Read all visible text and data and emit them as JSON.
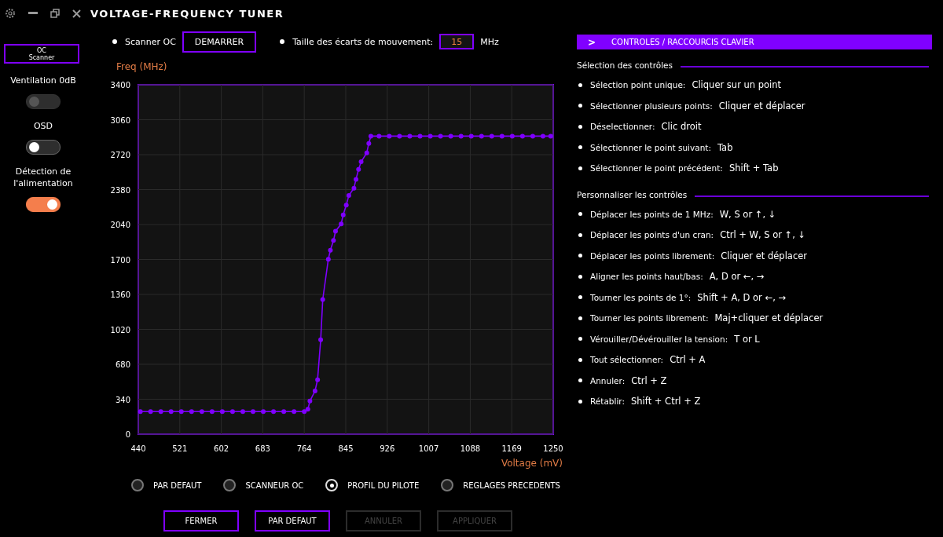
{
  "window": {
    "title": "VOLTAGE-FREQUENCY TUNER"
  },
  "sidebar": {
    "scanner_button": "OC\nScanner",
    "toggles": [
      {
        "label": "Ventilation 0dB",
        "on": false,
        "disabled": true
      },
      {
        "label": "OSD",
        "on": false,
        "disabled": false
      },
      {
        "label": "Détection de l'alimentation",
        "on": true,
        "disabled": false
      }
    ]
  },
  "controls": {
    "scanner_label": "Scanner OC",
    "start_button": "DEMARRER",
    "step_label": "Taille des écarts de mouvement:",
    "step_value": "15",
    "step_unit": "MHz"
  },
  "chart": {
    "chart_data": {
      "type": "line",
      "xlabel": "Voltage (mV)",
      "ylabel": "Freq (MHz)",
      "xlim": [
        440,
        1250
      ],
      "ylim": [
        0,
        3400
      ],
      "xticks": [
        440,
        521,
        602,
        683,
        764,
        845,
        926,
        1007,
        1088,
        1169,
        1250
      ],
      "yticks": [
        0,
        340,
        680,
        1020,
        1360,
        1700,
        2040,
        2380,
        2720,
        3060,
        3400
      ],
      "x": [
        444,
        464,
        484,
        504,
        524,
        544,
        564,
        584,
        604,
        624,
        644,
        664,
        684,
        704,
        724,
        744,
        764,
        771,
        775,
        785,
        790,
        796,
        800,
        811,
        815,
        821,
        825,
        836,
        840,
        846,
        851,
        861,
        865,
        870,
        875,
        886,
        890,
        894,
        910,
        930,
        950,
        970,
        990,
        1010,
        1030,
        1050,
        1070,
        1090,
        1110,
        1130,
        1150,
        1170,
        1190,
        1210,
        1230,
        1245
      ],
      "grid": true,
      "series": [
        {
          "color": "#7f00ff",
          "marker": true,
          "values": [
            220,
            220,
            220,
            220,
            220,
            220,
            220,
            220,
            220,
            220,
            220,
            220,
            220,
            220,
            220,
            220,
            220,
            242,
            323,
            420,
            530,
            919,
            1310,
            1702,
            1790,
            1885,
            1976,
            2045,
            2134,
            2230,
            2322,
            2394,
            2480,
            2577,
            2651,
            2738,
            2829,
            2900,
            2900,
            2900,
            2900,
            2900,
            2900,
            2900,
            2900,
            2900,
            2900,
            2900,
            2900,
            2900,
            2900,
            2900,
            2900,
            2900,
            2900,
            2900
          ]
        }
      ]
    }
  },
  "profiles": [
    {
      "label": "PAR DEFAUT",
      "selected": false
    },
    {
      "label": "SCANNEUR OC",
      "selected": false
    },
    {
      "label": "PROFIL DU PILOTE",
      "selected": true
    },
    {
      "label": "REGLAGES PRECEDENTS",
      "selected": false
    }
  ],
  "buttons": [
    {
      "label": "FERMER",
      "disabled": false
    },
    {
      "label": "PAR DEFAUT",
      "disabled": false
    },
    {
      "label": "ANNULER",
      "disabled": true
    },
    {
      "label": "APPLIQUER",
      "disabled": true
    }
  ],
  "shortcuts": {
    "chevron": ">",
    "title": "CONTROLES / RACCOURCIS CLAVIER",
    "sections": [
      {
        "title": "Sélection des contrôles",
        "items": [
          {
            "action": "Sélection point unique:",
            "keys": "Cliquer sur un point"
          },
          {
            "action": "Sélectionner plusieurs points:",
            "keys": "Cliquer et déplacer"
          },
          {
            "action": "Déselectionner:",
            "keys": "Clic droit"
          },
          {
            "action": "Sélectionner le point suivant:",
            "keys": "Tab"
          },
          {
            "action": "Sélectionner le point précédent:",
            "keys": "Shift + Tab"
          }
        ]
      },
      {
        "title": "Personnaliser les contrôles",
        "items": [
          {
            "action": "Déplacer les points de 1 MHz:",
            "keys": "W, S or ↑, ↓"
          },
          {
            "action": "Déplacer les points d'un cran:",
            "keys": "Ctrl + W, S or ↑, ↓"
          },
          {
            "action": "Déplacer les points librement:",
            "keys": "Cliquer et déplacer"
          },
          {
            "action": "Aligner les points haut/bas:",
            "keys": "A, D or ←, →"
          },
          {
            "action": "Tourner les points de 1°:",
            "keys": "Shift + A, D or ←, →"
          },
          {
            "action": "Tourner les points librement:",
            "keys": "Maj+cliquer et déplacer"
          },
          {
            "action": "Vérouiller/Dévérouiller la tension:",
            "keys": "T or L"
          },
          {
            "action": "Tout sélectionner:",
            "keys": "Ctrl + A"
          },
          {
            "action": "Annuler:",
            "keys": "Ctrl + Z"
          },
          {
            "action": "Rétablir:",
            "keys": "Shift + Ctrl + Z"
          }
        ]
      }
    ]
  }
}
